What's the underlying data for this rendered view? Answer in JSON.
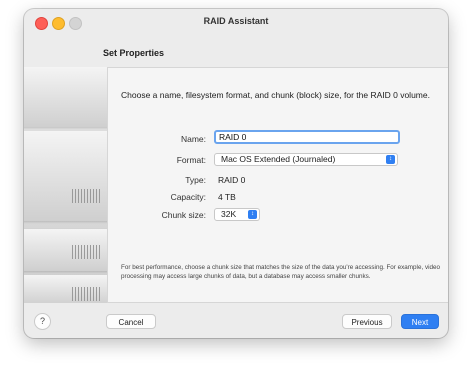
{
  "window": {
    "title": "RAID Assistant"
  },
  "section": {
    "title": "Set Properties"
  },
  "panel": {
    "description": "Choose a name, filesystem format, and chunk (block) size, for the RAID 0 volume.",
    "fields": {
      "name_label": "Name:",
      "name_value": "RAID 0",
      "format_label": "Format:",
      "format_value": "Mac OS Extended (Journaled)",
      "type_label": "Type:",
      "type_value": "RAID 0",
      "capacity_label": "Capacity:",
      "capacity_value": "4 TB",
      "chunk_label": "Chunk size:",
      "chunk_value": "32K"
    },
    "help_text": "For best performance, choose a chunk size that matches the size of the data you're accessing. For example, video processing may access large chunks of data, but a database may access smaller chunks."
  },
  "footer": {
    "help_label": "?",
    "cancel_label": "Cancel",
    "previous_label": "Previous",
    "next_label": "Next"
  },
  "icons": {
    "popup_chevron": "chevron-updown-icon"
  },
  "colors": {
    "accent": "#2f7ff2",
    "focus_ring": "#6aa4ee"
  }
}
